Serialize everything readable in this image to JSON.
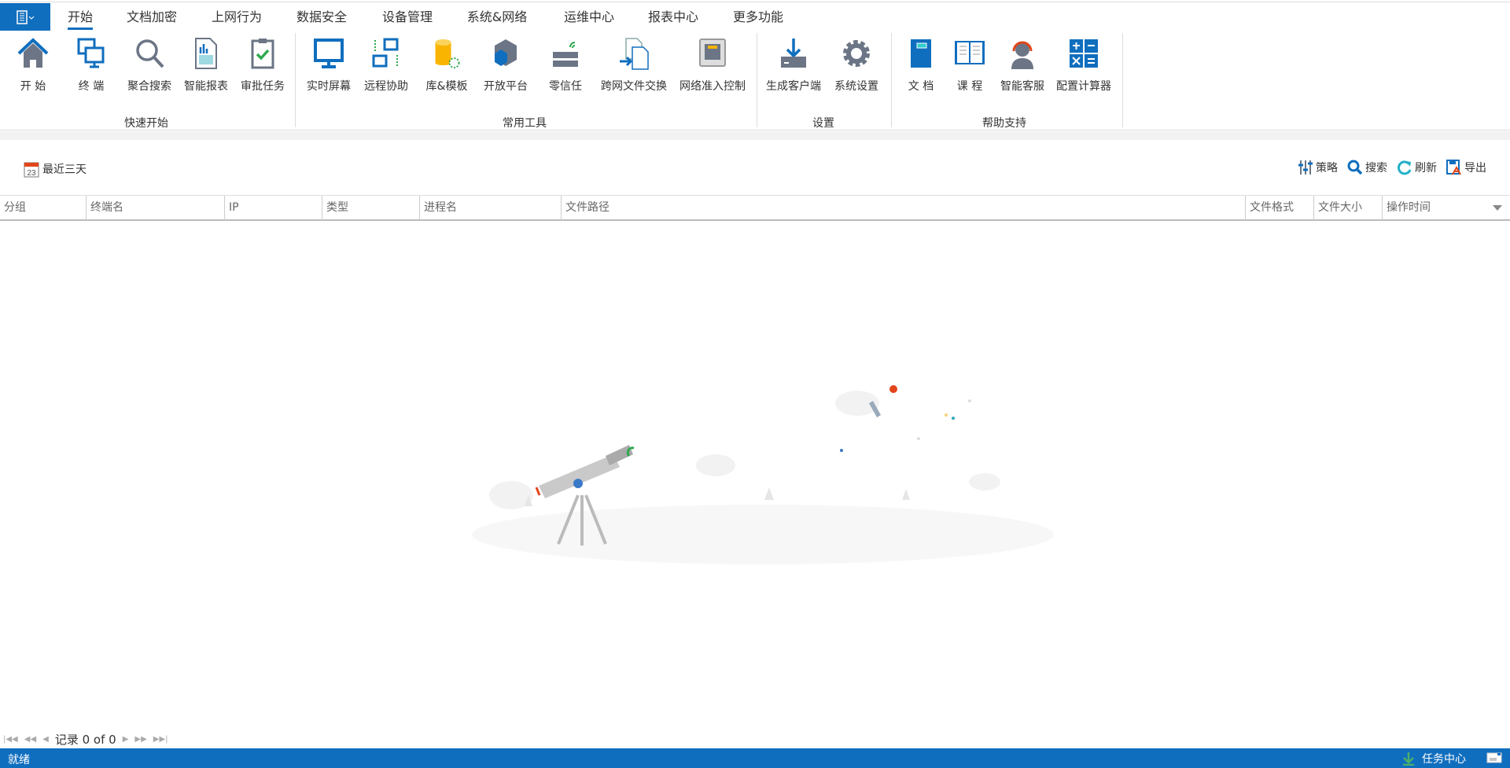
{
  "tabs": [
    "开始",
    "文档加密",
    "上网行为",
    "数据安全",
    "设备管理",
    "系统&网络",
    "运维中心",
    "报表中心",
    "更多功能"
  ],
  "active_tab": "开始",
  "ribbon": {
    "groups": [
      {
        "label": "快速开始",
        "items": [
          "开 始",
          "终 端",
          "聚合搜索",
          "智能报表",
          "审批任务"
        ]
      },
      {
        "label": "常用工具",
        "items": [
          "实时屏幕",
          "远程协助",
          "库&模板",
          "开放平台",
          "零信任",
          "跨网文件交换",
          "网络准入控制"
        ]
      },
      {
        "label": "设置",
        "items": [
          "生成客户端",
          "系统设置"
        ]
      },
      {
        "label": "帮助支持",
        "items": [
          "文 档",
          "课 程",
          "智能客服",
          "配置计算器"
        ]
      }
    ]
  },
  "filter": {
    "icon_text": "23",
    "label": "最近三天"
  },
  "toolbar": {
    "strategy": "策略",
    "search": "搜索",
    "refresh": "刷新",
    "export": "导出"
  },
  "table": {
    "columns": [
      "分组",
      "终端名",
      "IP",
      "类型",
      "进程名",
      "文件路径",
      "文件格式",
      "文件大小",
      "操作时间"
    ],
    "rows": []
  },
  "pager": {
    "text": "记录 0 of 0"
  },
  "status": {
    "ready": "就绪",
    "task_center": "任务中心"
  },
  "colors": {
    "accent": "#106ebe",
    "icon_gray": "#6b7585"
  }
}
